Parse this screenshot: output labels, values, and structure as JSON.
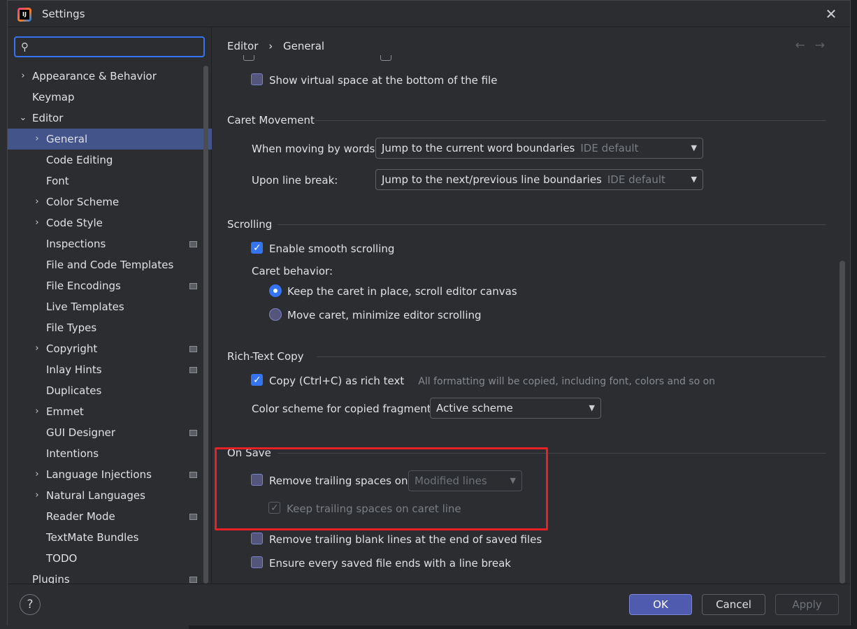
{
  "window": {
    "title": "Settings"
  },
  "sidebar": {
    "search_placeholder": "",
    "items": [
      {
        "label": "Appearance & Behavior",
        "level": 0,
        "arrow": "›"
      },
      {
        "label": "Keymap",
        "level": 0,
        "arrow": ""
      },
      {
        "label": "Editor",
        "level": 0,
        "arrow": "⌄"
      },
      {
        "label": "General",
        "level": 1,
        "arrow": "›",
        "selected": true
      },
      {
        "label": "Code Editing",
        "level": 1,
        "arrow": ""
      },
      {
        "label": "Font",
        "level": 1,
        "arrow": ""
      },
      {
        "label": "Color Scheme",
        "level": 1,
        "arrow": "›"
      },
      {
        "label": "Code Style",
        "level": 1,
        "arrow": "›"
      },
      {
        "label": "Inspections",
        "level": 1,
        "arrow": "",
        "project_icon": true
      },
      {
        "label": "File and Code Templates",
        "level": 1,
        "arrow": ""
      },
      {
        "label": "File Encodings",
        "level": 1,
        "arrow": "",
        "project_icon": true
      },
      {
        "label": "Live Templates",
        "level": 1,
        "arrow": ""
      },
      {
        "label": "File Types",
        "level": 1,
        "arrow": ""
      },
      {
        "label": "Copyright",
        "level": 1,
        "arrow": "›",
        "project_icon": true
      },
      {
        "label": "Inlay Hints",
        "level": 1,
        "arrow": "",
        "project_icon": true
      },
      {
        "label": "Duplicates",
        "level": 1,
        "arrow": ""
      },
      {
        "label": "Emmet",
        "level": 1,
        "arrow": "›"
      },
      {
        "label": "GUI Designer",
        "level": 1,
        "arrow": "",
        "project_icon": true
      },
      {
        "label": "Intentions",
        "level": 1,
        "arrow": ""
      },
      {
        "label": "Language Injections",
        "level": 1,
        "arrow": "›",
        "project_icon": true
      },
      {
        "label": "Natural Languages",
        "level": 1,
        "arrow": "›"
      },
      {
        "label": "Reader Mode",
        "level": 1,
        "arrow": "",
        "project_icon": true
      },
      {
        "label": "TextMate Bundles",
        "level": 1,
        "arrow": ""
      },
      {
        "label": "TODO",
        "level": 1,
        "arrow": ""
      },
      {
        "label": "Plugins",
        "level": 0,
        "arrow": "",
        "project_icon": true
      }
    ]
  },
  "breadcrumb": {
    "parent": "Editor",
    "separator": "›",
    "current": "General",
    "back_icon": "←",
    "forward_icon": "→"
  },
  "content": {
    "virtual_space": "Show virtual space at the bottom of the file",
    "caret_movement": {
      "title": "Caret Movement",
      "words_label": "When moving by words:",
      "words_value": "Jump to the current word boundaries",
      "words_note": "IDE default",
      "line_break_label": "Upon line break:",
      "line_break_value": "Jump to the next/previous line boundaries",
      "line_break_note": "IDE default"
    },
    "scrolling": {
      "title": "Scrolling",
      "smooth": "Enable smooth scrolling",
      "caret_behavior": "Caret behavior:",
      "radio_keep": "Keep the caret in place, scroll editor canvas",
      "radio_move": "Move caret, minimize editor scrolling"
    },
    "rich_text": {
      "title": "Rich-Text Copy",
      "copy": "Copy (Ctrl+C) as rich text",
      "copy_hint": "All formatting will be copied, including font, colors and so on",
      "scheme_label": "Color scheme for copied fragment:",
      "scheme_value": "Active scheme"
    },
    "on_save": {
      "title": "On Save",
      "remove_trailing": "Remove trailing spaces on:",
      "remove_trailing_value": "Modified lines",
      "keep_caret": "Keep trailing spaces on caret line",
      "remove_blank": "Remove trailing blank lines at the end of saved files",
      "ensure_break": "Ensure every saved file ends with a line break"
    }
  },
  "footer": {
    "help": "?",
    "ok": "OK",
    "cancel": "Cancel",
    "apply": "Apply"
  },
  "colors": {
    "accent": "#3574f0",
    "selection": "#43548a",
    "highlight_box": "#e82127"
  }
}
